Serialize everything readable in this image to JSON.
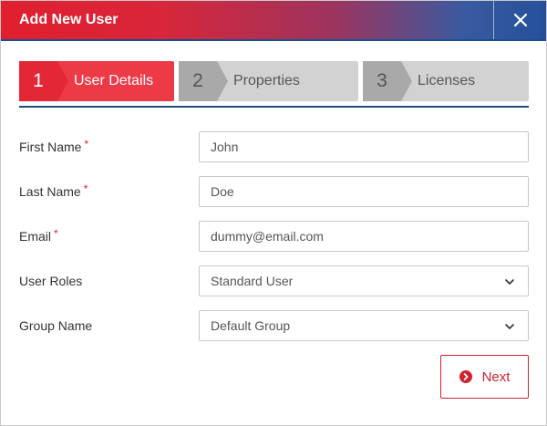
{
  "dialog": {
    "title": "Add New User",
    "close_icon": "close-icon"
  },
  "steps": [
    {
      "number": "1",
      "label": "User Details",
      "state": "active"
    },
    {
      "number": "2",
      "label": "Properties",
      "state": "inactive"
    },
    {
      "number": "3",
      "label": "Licenses",
      "state": "inactive"
    }
  ],
  "form": {
    "first_name": {
      "label": "First Name",
      "required_mark": "*",
      "value": "John"
    },
    "last_name": {
      "label": "Last Name",
      "required_mark": "*",
      "value": "Doe"
    },
    "email": {
      "label": "Email",
      "required_mark": "*",
      "value": "dummy@email.com"
    },
    "user_roles": {
      "label": "User Roles",
      "selected": "Standard User",
      "icon": "chevron-down-icon"
    },
    "group_name": {
      "label": "Group Name",
      "selected": "Default Group",
      "icon": "chevron-down-icon"
    }
  },
  "actions": {
    "next_label": "Next",
    "next_icon": "chevron-right-circle-icon"
  },
  "colors": {
    "accent_red": "#e32736",
    "step_active": "#ec3b47",
    "step_inactive": "#d2d2d2",
    "divider_blue": "#1d4f7e",
    "header_gradient_end": "#24509b"
  }
}
